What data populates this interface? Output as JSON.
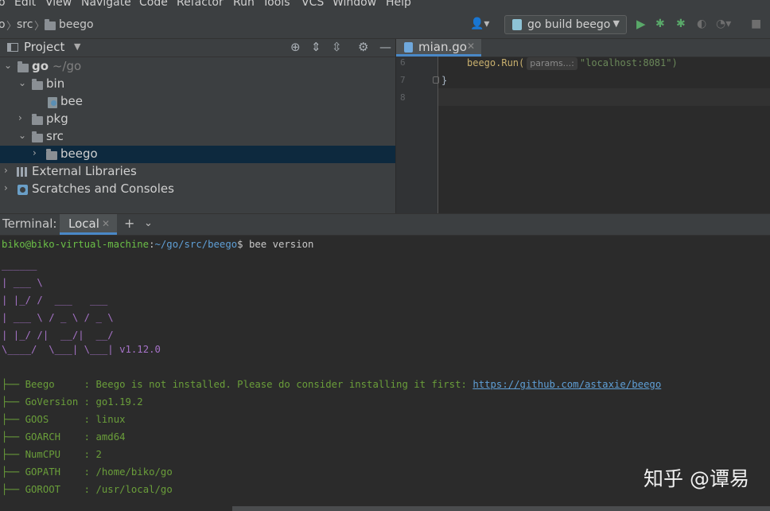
{
  "menubar": {
    "items": [
      "o",
      "Edit",
      "View",
      "Navigate",
      "Code",
      "Refactor",
      "Run",
      "Tools",
      "VCS",
      "Window",
      "Help"
    ]
  },
  "navbar": {
    "crumbs": [
      "o",
      "src",
      "beego"
    ],
    "run_config": "go build beego"
  },
  "project": {
    "title": "Project",
    "tree": [
      {
        "label": "go",
        "suffix": "~/go"
      },
      {
        "label": "bin"
      },
      {
        "label": "bee"
      },
      {
        "label": "pkg"
      },
      {
        "label": "src"
      },
      {
        "label": "beego"
      },
      {
        "label": "External Libraries"
      },
      {
        "label": "Scratches and Consoles"
      }
    ]
  },
  "editor": {
    "tab_name": "mian.go",
    "lines": [
      {
        "no": "6",
        "pre": "beego.Run(",
        "hint": "params...:",
        "post": "\"localhost:8081\")"
      },
      {
        "no": "7",
        "text": "}"
      },
      {
        "no": "8",
        "text": ""
      }
    ]
  },
  "terminal": {
    "label": "Terminal:",
    "tab": "Local",
    "prompt_user": "biko@biko-virtual-machine",
    "prompt_sep": ":",
    "prompt_path": "~/go/src/beego",
    "prompt_dollar": "$",
    "command": " bee version",
    "logo": [
      "______",
      "| ___ \\",
      "| |_/ /  ___   ___",
      "| ___ \\ / _ \\ / _ \\",
      "| |_/ /|  __/|  __/",
      "\\____/  \\___| \\___|"
    ],
    "version": "v1.12.0",
    "info": [
      {
        "key": "Beego    ",
        "value": "Beego is not installed. Please do consider installing it first: ",
        "link": "https://github.com/astaxie/beego"
      },
      {
        "key": "GoVersion",
        "value": "go1.19.2"
      },
      {
        "key": "GOOS     ",
        "value": "linux"
      },
      {
        "key": "GOARCH   ",
        "value": "amd64"
      },
      {
        "key": "NumCPU   ",
        "value": "2"
      },
      {
        "key": "GOPATH   ",
        "value": "/home/biko/go"
      },
      {
        "key": "GOROOT   ",
        "value": "/usr/local/go"
      }
    ],
    "tree_glyph": "├── "
  },
  "watermark": "知乎 @谭易"
}
